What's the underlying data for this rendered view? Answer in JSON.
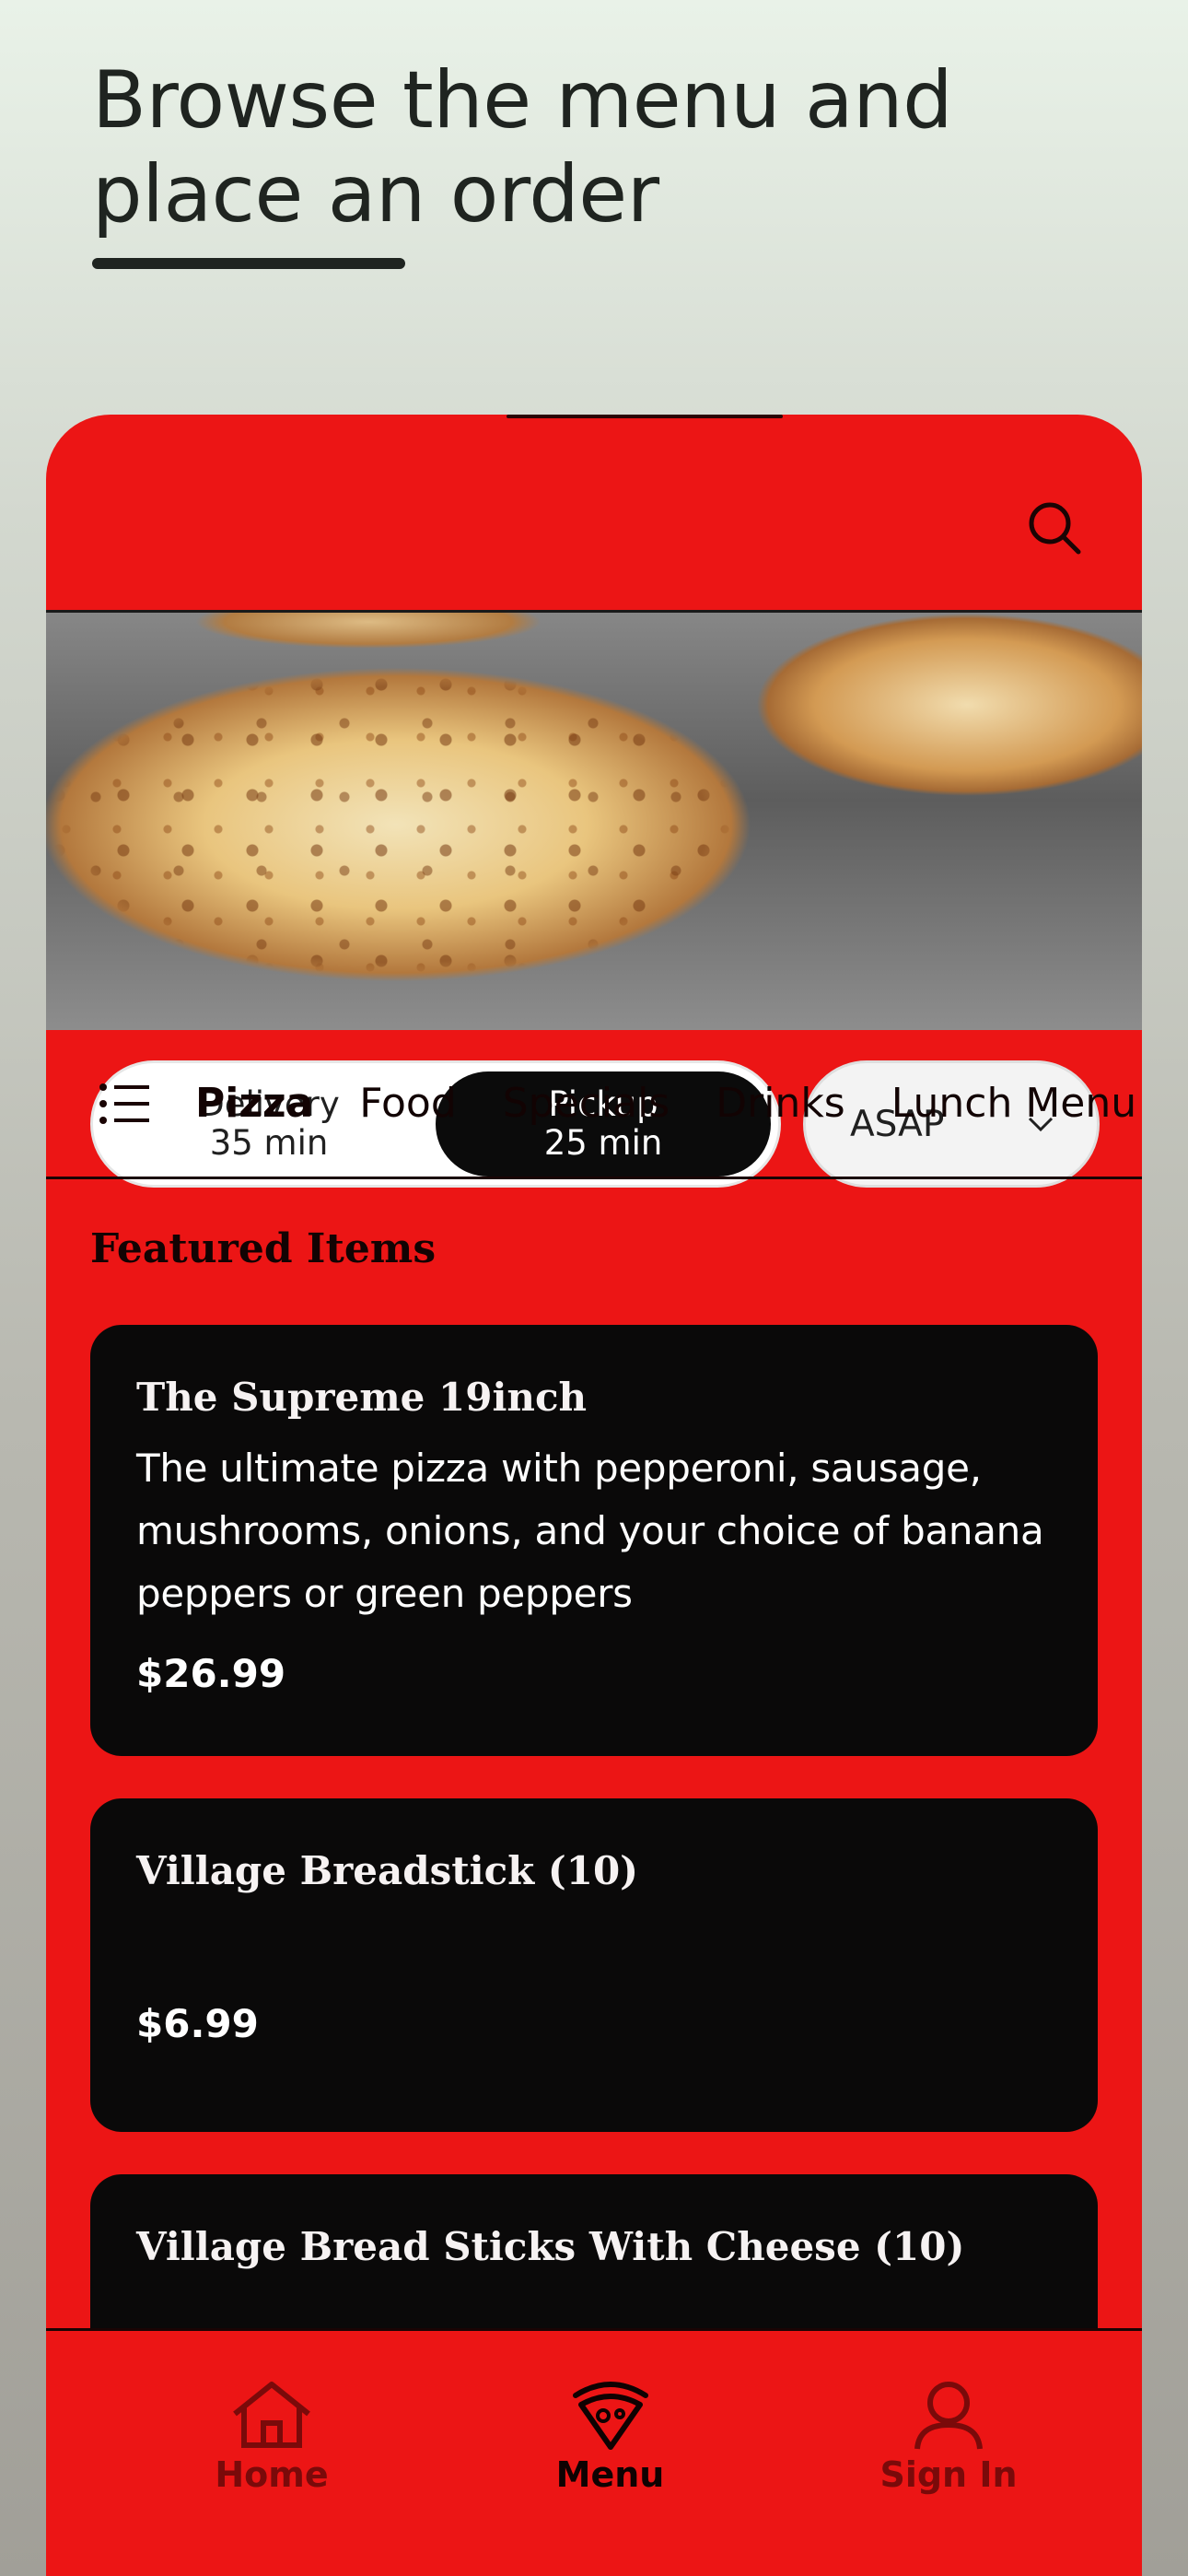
{
  "promo": {
    "title_line1": "Browse the menu and",
    "title_line2": "place an order"
  },
  "header": {
    "search_icon": "search-icon"
  },
  "order_mode": {
    "delivery": {
      "label": "Delivery",
      "time": "35 min"
    },
    "pickup": {
      "label": "Pickup",
      "time": "25 min"
    },
    "selected": "pickup"
  },
  "time_select": {
    "value": "ASAP",
    "icon": "chevron-down-icon"
  },
  "categories": {
    "icon": "list-icon",
    "items": [
      "Pizza",
      "Food",
      "Specials",
      "Drinks",
      "Lunch Menu"
    ],
    "active": "Pizza"
  },
  "featured": {
    "heading": "Featured Items",
    "items": [
      {
        "name": "The Supreme 19inch",
        "description": "The ultimate pizza with pepperoni, sausage, mushrooms, onions, and your choice of banana peppers or green peppers",
        "price": "$26.99"
      },
      {
        "name": "Village Breadstick (10)",
        "description": "",
        "price": "$6.99"
      },
      {
        "name": "Village Bread Sticks With Cheese (10)",
        "description": "",
        "price": ""
      }
    ]
  },
  "bottom_nav": {
    "items": [
      {
        "label": "Home",
        "icon": "home-icon"
      },
      {
        "label": "Menu",
        "icon": "pizza-slice-icon"
      },
      {
        "label": "Sign In",
        "icon": "user-icon"
      }
    ],
    "active": "Menu"
  },
  "colors": {
    "brand_red": "#ec1515",
    "card_black": "#0a0909",
    "background_top": "#e9f2e8",
    "background_bottom": "#a19f98"
  }
}
